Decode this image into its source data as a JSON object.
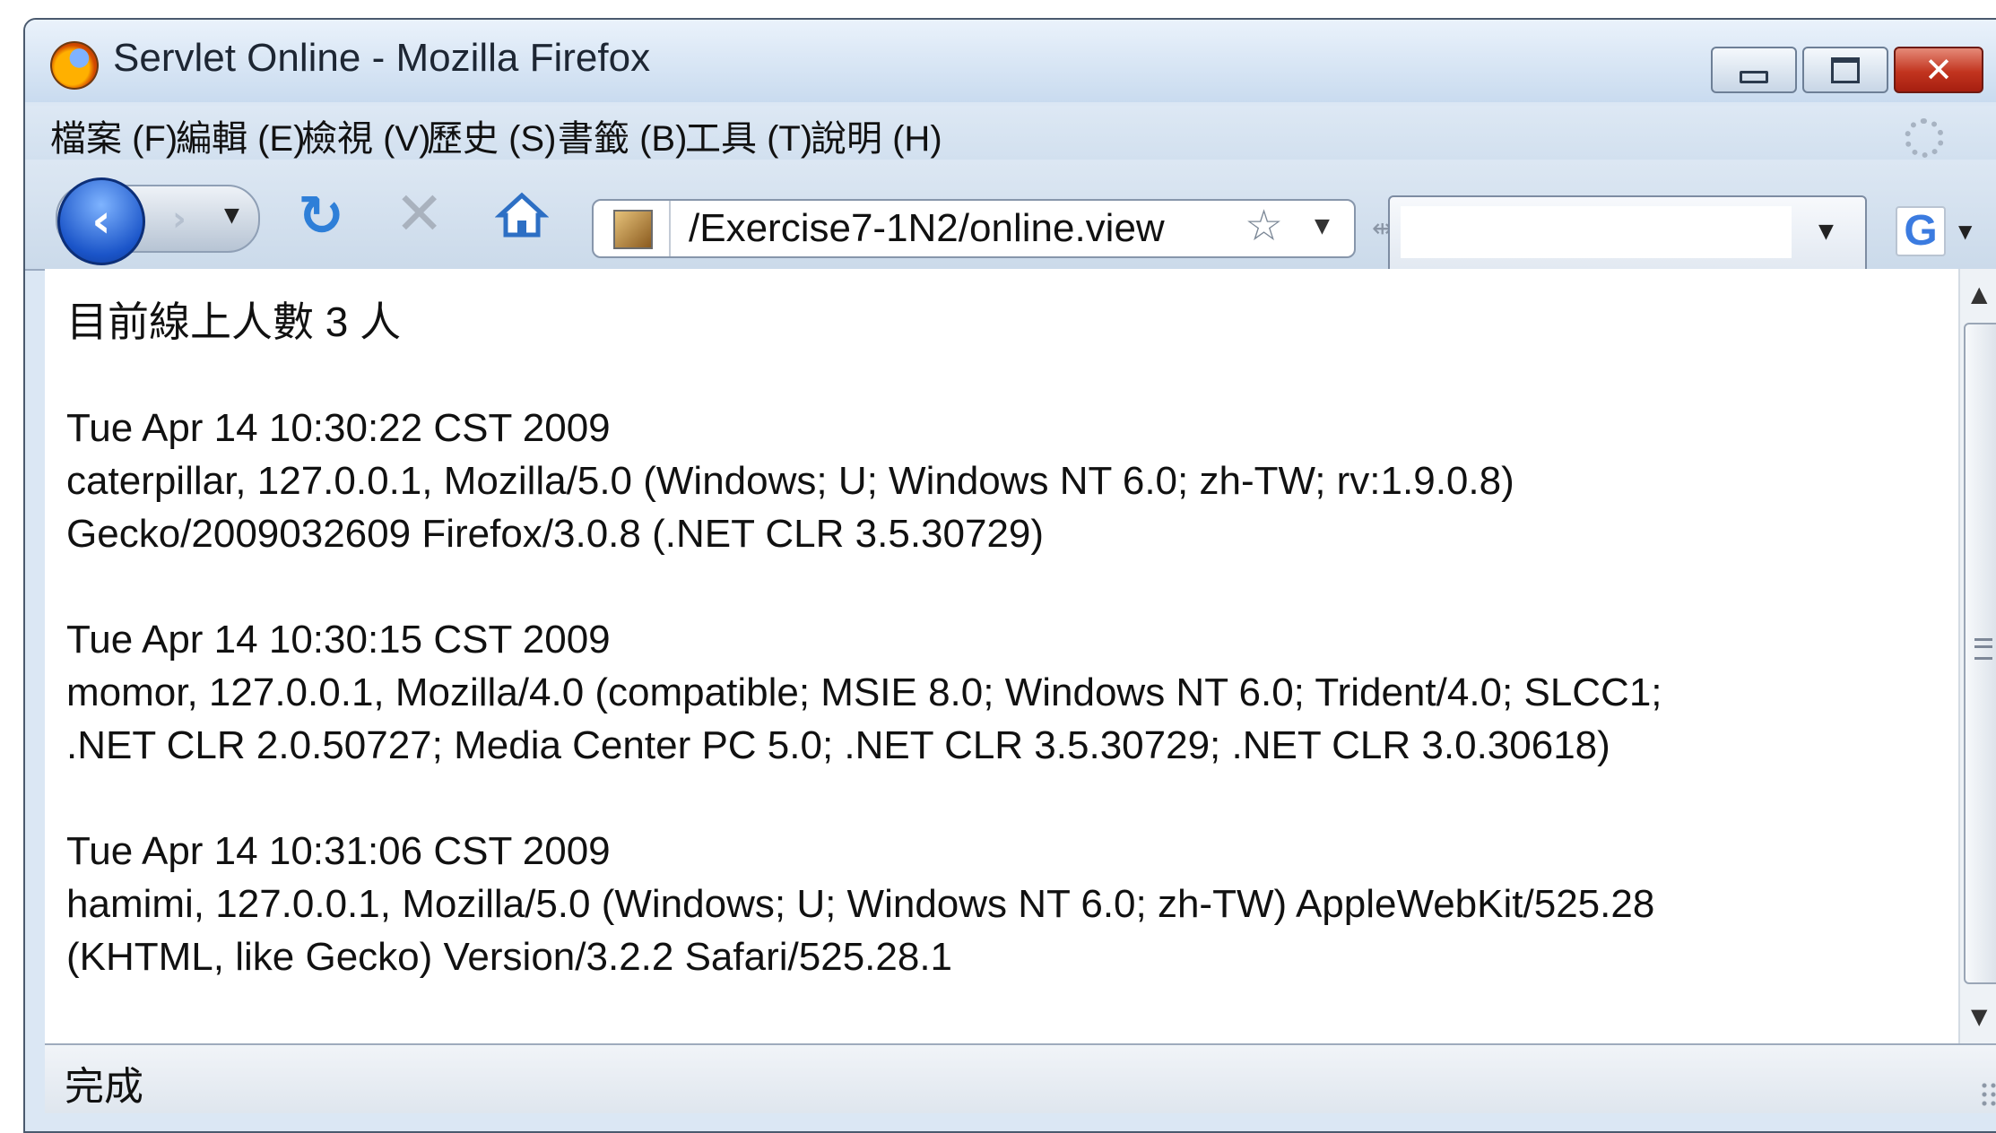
{
  "window": {
    "title": "Servlet Online - Mozilla Firefox",
    "controls": {
      "minimize": "—",
      "maximize": "□",
      "close": "✕"
    }
  },
  "menu": {
    "items": [
      "檔案 (F)",
      "編輯 (E)",
      "檢視 (V)",
      "歷史 (S)",
      "書籤 (B)",
      "工具 (T)",
      "說明 (H)"
    ]
  },
  "toolbar": {
    "back_icon": "back-arrow",
    "forward_icon": "forward-arrow",
    "reload_icon": "reload",
    "stop_icon": "stop",
    "home_icon": "home",
    "url": "/Exercise7-1N2/online.view",
    "search_value": "",
    "search_engine_icon": "G"
  },
  "content": {
    "online_count_line": "目前線上人數 3 人",
    "entries": [
      {
        "time": "Tue Apr 14 10:30:22 CST 2009",
        "line1": "caterpillar, 127.0.0.1, Mozilla/5.0 (Windows; U; Windows NT 6.0; zh-TW; rv:1.9.0.8)",
        "line2": "Gecko/2009032609 Firefox/3.0.8 (.NET CLR 3.5.30729)"
      },
      {
        "time": "Tue Apr 14 10:30:15 CST 2009",
        "line1": "momor, 127.0.0.1, Mozilla/4.0 (compatible; MSIE 8.0; Windows NT 6.0; Trident/4.0; SLCC1;",
        "line2": ".NET CLR 2.0.50727; Media Center PC 5.0; .NET CLR 3.5.30729; .NET CLR 3.0.30618)"
      },
      {
        "time": "Tue Apr 14 10:31:06 CST 2009",
        "line1": "hamimi, 127.0.0.1, Mozilla/5.0 (Windows; U; Windows NT 6.0; zh-TW) AppleWebKit/525.28",
        "line2": "(KHTML, like Gecko) Version/3.2.2 Safari/525.28.1"
      }
    ]
  },
  "status": {
    "text": "完成"
  }
}
